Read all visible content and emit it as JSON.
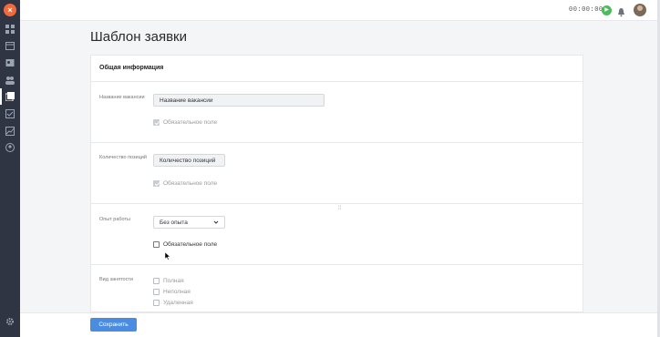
{
  "app": {
    "logo_text": "×"
  },
  "topbar": {
    "timer": "00:00:00",
    "play_symbol": "▶"
  },
  "page": {
    "title": "Шаблон заявки"
  },
  "card": {
    "header": "Общая информация",
    "sections": {
      "vacancy_name": {
        "label": "Название вакансии",
        "value": "Название вакансии",
        "required_label": "Обязательное поле",
        "required": true
      },
      "positions": {
        "label": "Количество позиций",
        "value": "Количество позиций",
        "required_label": "Обязательное поле",
        "required": true
      },
      "experience": {
        "label": "Опыт работы",
        "selected": "Без опыта",
        "required_label": "Обязательное поле",
        "required": false
      },
      "employment": {
        "label": "Вид занятости",
        "options": [
          "Полная",
          "Неполная",
          "Удаленная"
        ]
      }
    }
  },
  "footer": {
    "save_label": "Сохранить"
  },
  "colors": {
    "sidebar": "#2f3542",
    "accent": "#4a8de0",
    "logo": "#f26a3c",
    "play": "#4cbb5e"
  }
}
